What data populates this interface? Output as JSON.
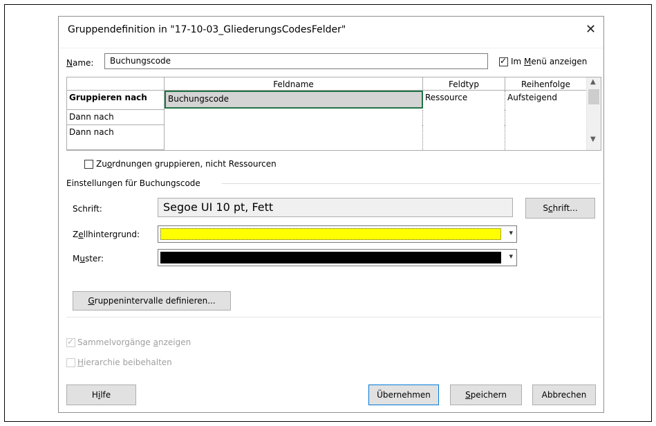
{
  "dialog": {
    "title": "Gruppendefinition in \"17-10-03_GliederungsCodesFelder\"",
    "close_icon": "close-icon"
  },
  "name": {
    "label_u": "N",
    "label_rest": "ame:",
    "value": "Buchungscode"
  },
  "show_in_menu": {
    "checked": true,
    "label_pre": "Im ",
    "label_u": "M",
    "label_rest": "enü anzeigen"
  },
  "grid": {
    "columns": [
      "Feldname",
      "Feldtyp",
      "Reihenfolge"
    ],
    "rows": [
      {
        "header": "Gruppieren nach",
        "field": "Buchungscode",
        "type": "Ressource",
        "order": "Aufsteigend"
      },
      {
        "header": "Dann nach",
        "field": "",
        "type": "",
        "order": ""
      },
      {
        "header": "Dann nach",
        "field": "",
        "type": "",
        "order": ""
      }
    ],
    "scroll_up_icon": "chevron-up-icon",
    "scroll_down_icon": "chevron-down-icon"
  },
  "assignments": {
    "checked": false,
    "label_pre": "Zu",
    "label_u": "o",
    "label_rest": "rdnungen gruppieren, nicht Ressourcen"
  },
  "settings": {
    "section_label": "Einstellungen für Buchungscode",
    "font_label": "Schrift:",
    "font_value": "Segoe UI 10 pt, Fett",
    "font_button_pre": "S",
    "font_button_u": "c",
    "font_button_rest": "hrift...",
    "cell_bg_label_pre": "Z",
    "cell_bg_label_u": "e",
    "cell_bg_label_rest": "llhintergrund:",
    "cell_bg_color": "#ffff00",
    "pattern_label_pre": "M",
    "pattern_label_u": "u",
    "pattern_label_rest": "ster:",
    "pattern_color": "#000000",
    "intervals_button_u": "G",
    "intervals_button_rest": "ruppenintervalle definieren..."
  },
  "options": {
    "summary_checked": true,
    "summary_label_pre": "Sammelvorgänge ",
    "summary_label_u": "a",
    "summary_label_rest": "nzeigen",
    "hierarchy_checked": false,
    "hierarchy_label_u": "H",
    "hierarchy_label_rest": "ierarchie beibehalten"
  },
  "buttons": {
    "help_pre": "H",
    "help_u": "i",
    "help_rest": "lfe",
    "apply": "Übernehmen",
    "save_u": "S",
    "save_rest": "peichern",
    "cancel": "Abbrechen"
  },
  "colors": {
    "selection_border": "#217346",
    "primary_border": "#0078d7"
  }
}
